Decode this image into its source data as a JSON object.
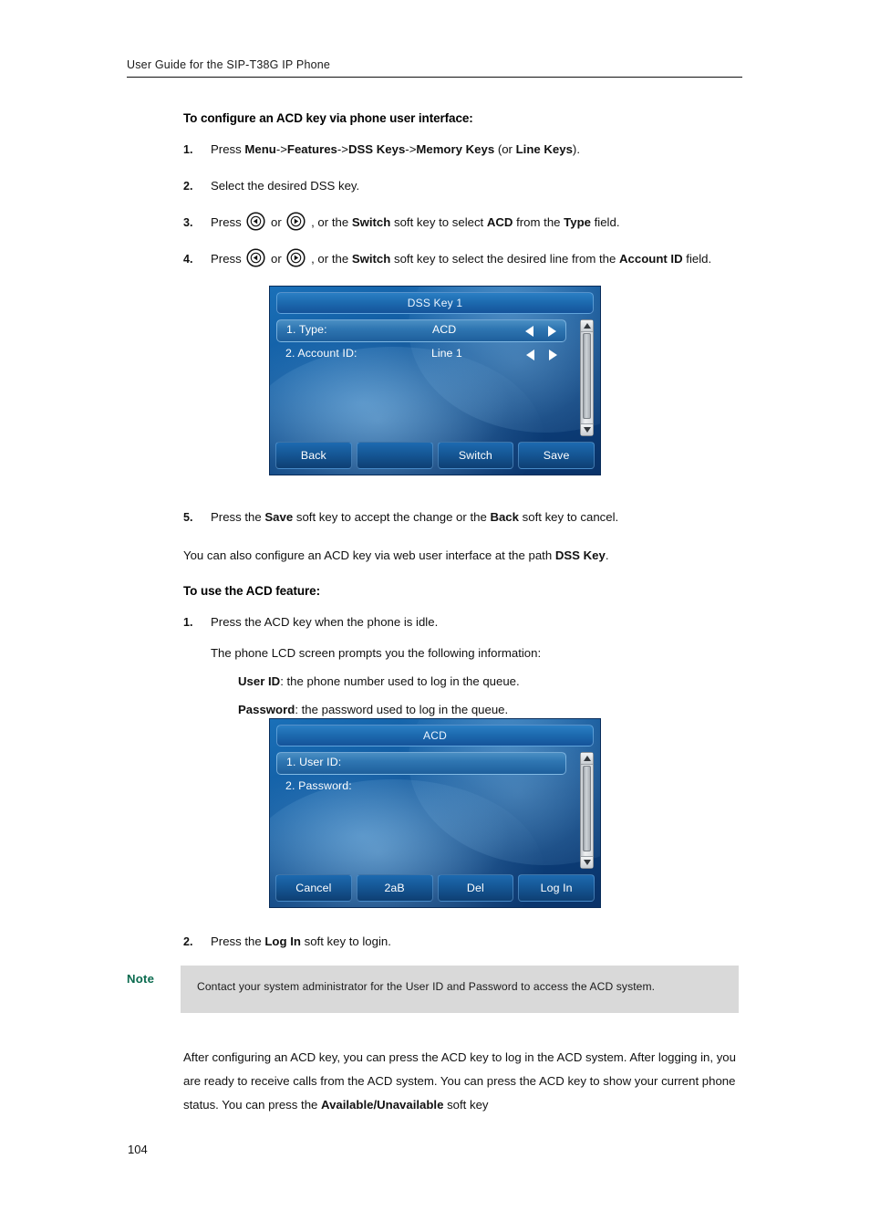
{
  "document": {
    "header_title": "User Guide for the SIP-T38G IP Phone",
    "page_number": "104"
  },
  "sections": {
    "configure_heading": "To configure an ACD key via phone user interface:",
    "use_heading": "To use the ACD feature:"
  },
  "steps_configure": [
    {
      "num": "1.",
      "text_parts": {
        "p1": "Press ",
        "b1": "Menu",
        "p2": "->",
        "b2": "Features",
        "p3": "->",
        "b3": "DSS Keys",
        "p4": "->",
        "b4": "Memory Keys",
        "p5": " (or ",
        "b5": "Line Keys",
        "p6": ")."
      }
    },
    {
      "num": "2.",
      "text": "Select the desired DSS key."
    },
    {
      "num": "3.",
      "text_parts": {
        "p1": "Press ",
        "p2": " or ",
        "p3": " , or the ",
        "b1": "Switch",
        "p4": " soft key to select ",
        "b2": "ACD",
        "p5": " from the ",
        "b3": "Type",
        "p6": " field."
      }
    },
    {
      "num": "4.",
      "text_parts": {
        "p1": "Press ",
        "p2": " or ",
        "p3": " , or the ",
        "b1": "Switch",
        "p4": " soft key to select the desired line from the ",
        "b2": "Account ID",
        "p5": " field."
      }
    },
    {
      "num": "5.",
      "text_parts": {
        "p1": "Press the ",
        "b1": "Save",
        "p2": " soft key to accept the change or the ",
        "b2": "Back",
        "p3": " soft key to cancel."
      }
    }
  ],
  "web_ui_note": {
    "p1": "You can also configure an ACD key via web user interface at the path ",
    "b1": "DSS Key",
    "p2": "."
  },
  "steps_use": [
    {
      "num": "1.",
      "text": "Press the ACD key when the phone is idle.",
      "sub": "The phone LCD screen prompts you the following information:",
      "details": [
        {
          "bold": "User ID",
          "rest": ": the phone number used to log in the queue."
        },
        {
          "bold": "Password",
          "rest": ": the password used to log in the queue."
        }
      ]
    },
    {
      "num": "2.",
      "text_parts": {
        "p1": "Press the ",
        "b1": "Log In",
        "p2": " soft key to login."
      }
    }
  ],
  "phone_screen_dss": {
    "title": "DSS Key 1",
    "rows": [
      {
        "label": "1. Type:",
        "value": "ACD",
        "selected": true,
        "arrows": true
      },
      {
        "label": "2. Account ID:",
        "value": "Line 1",
        "selected": false,
        "arrows": true
      }
    ],
    "softkeys": [
      "Back",
      "",
      "Switch",
      "Save"
    ],
    "scrollbar": {
      "up_icon": "caret-up-icon",
      "down_icon": "caret-down-icon"
    }
  },
  "phone_screen_acd": {
    "title": "ACD",
    "rows": [
      {
        "label": "1. User ID:",
        "value": "",
        "selected": true,
        "arrows": false
      },
      {
        "label": "2. Password:",
        "value": "",
        "selected": false,
        "arrows": false
      }
    ],
    "softkeys": [
      "Cancel",
      "2aB",
      "Del",
      "Log In"
    ],
    "scrollbar": {
      "up_icon": "caret-up-icon",
      "down_icon": "caret-down-icon"
    }
  },
  "note": {
    "label": "Note",
    "body": "Contact your system administrator for the User ID and Password to access the ACD system."
  },
  "closing_paragraph": {
    "p1": "After configuring an ACD key, you can press the ACD key to log in the ACD system. After logging in, you are ready to receive calls from the ACD system. You can press the ACD key to show your current phone status. You can press the ",
    "b1": "Available/Unavailable",
    "p2": " soft key"
  },
  "colors": {
    "note_label": "#0b6b4f",
    "note_background": "#d9d9d9",
    "phone_screen_blue": "#125da3",
    "text": "#111111"
  }
}
